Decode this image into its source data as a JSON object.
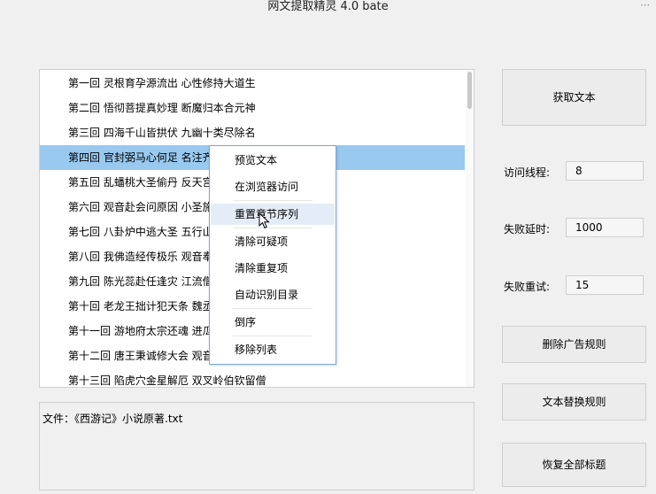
{
  "window": {
    "title": "网文提取精灵 4.0 bate",
    "more_icon": "⋯"
  },
  "chapters": [
    "第一回 灵根育孕源流出 心性修持大道生",
    "第二回 悟彻菩提真妙理 断魔归本合元神",
    "第三回 四海千山皆拱伏 九幽十类尽除名",
    "第四回 官封弼马心何足 名注齐",
    "第五回 乱蟠桃大圣偷丹 反天宫",
    "第六回 观音赴会问原因 小圣施",
    "第七回 八卦炉中逃大圣 五行山",
    "第八回 我佛造经传极乐 观音奉",
    "第九回 陈光蕊赴任逢灾 江流僧",
    "第十回 老龙王拙计犯天条 魏丞",
    "第十一回 游地府太宗还魂 进瓜",
    "第十二回 唐王秉诚修大会 观音",
    "第十三回 陷虎穴金星解厄 双叉岭伯钦留僧"
  ],
  "selected_chapter_index": 3,
  "file_panel": {
    "text": "文件：《西游记》小说原著.txt"
  },
  "buttons": {
    "get_text": "获取文本",
    "delete_ad_rules": "删除广告规则",
    "text_replace_rules": "文本替换规则",
    "restore_all_titles": "恢复全部标题"
  },
  "settings": {
    "threads_label": "访问线程:",
    "threads_value": "8",
    "fail_delay_label": "失败延时:",
    "fail_delay_value": "1000",
    "fail_retry_label": "失败重试:",
    "fail_retry_value": "15"
  },
  "context_menu": {
    "items": [
      "预览文本",
      "在浏览器访问",
      "重置章节序列",
      "清除可疑项",
      "清除重复项",
      "自动识别目录",
      "倒序",
      "移除列表"
    ],
    "hovered_index": 2
  },
  "colors": {
    "selection": "#99c9ef",
    "menu_border": "#7aa7d6",
    "menu_hover": "#e4edf7",
    "window_bg": "#f0f0f0"
  }
}
